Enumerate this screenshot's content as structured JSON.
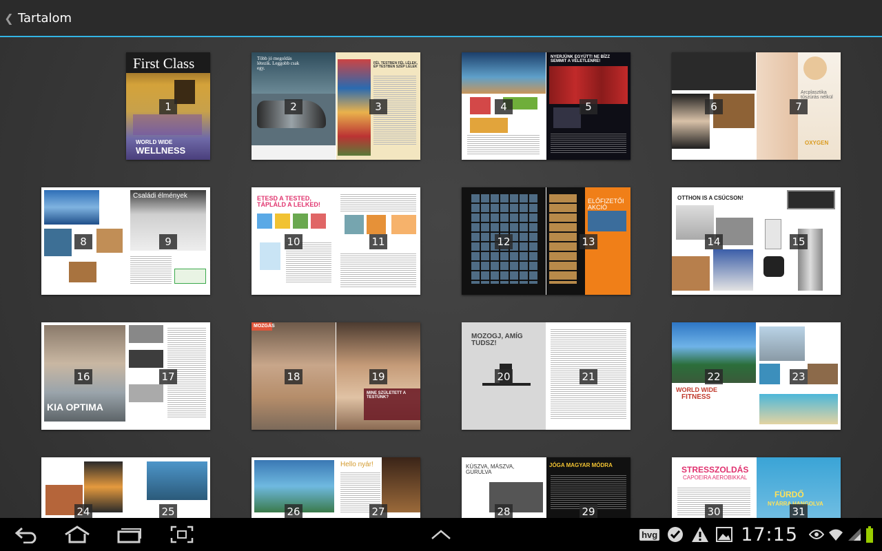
{
  "actionbar": {
    "title": "Tartalom",
    "back_icon": "chevron-left-icon"
  },
  "spreads": [
    {
      "pages": [
        "1"
      ],
      "cover_title": "First Class",
      "cover_tag": "WORLD WIDE",
      "cover_sub": "WELLNESS"
    },
    {
      "pages": [
        "2",
        "3"
      ],
      "left_text": "Több jó megoldás létezik. Leggobb csak egy.",
      "right_text": "FÉL TESTBEN FÉL LÉLEK, ÉP TESTBEN SZÉP LÉLEK"
    },
    {
      "pages": [
        "4",
        "5"
      ],
      "right_text": "NYERJÜNK EGYÜTT! NE BÍZZ SEMMIT A VÉLETLENRE!"
    },
    {
      "pages": [
        "6",
        "7"
      ],
      "right_text": "Arcplasztika tűszúrás nélkül",
      "right_sub": "OXYGEN"
    },
    {
      "pages": [
        "8",
        "9"
      ],
      "right_text": "Családi élmények"
    },
    {
      "pages": [
        "10",
        "11"
      ],
      "left_text": "ETESD A TESTED, TÁPLÁLD A LELKED!"
    },
    {
      "pages": [
        "12",
        "13"
      ],
      "right_text": "ELŐFIZETŐI AKCIÓ"
    },
    {
      "pages": [
        "14",
        "15"
      ],
      "left_text": "OTTHON IS A CSÚCSON!"
    },
    {
      "pages": [
        "16",
        "17"
      ],
      "left_text": "KIA OPTIMA"
    },
    {
      "pages": [
        "18",
        "19"
      ],
      "left_tag": "MOZGÁS",
      "right_text": "MINE SZÜLETETT A TESTÜNK?"
    },
    {
      "pages": [
        "20",
        "21"
      ],
      "left_text": "MOZOGJ, AMÍG TUDSZ!"
    },
    {
      "pages": [
        "22",
        "23"
      ],
      "left_text": "WORLD WIDE",
      "left_sub": "FITNESS"
    },
    {
      "pages": [
        "24",
        "25"
      ]
    },
    {
      "pages": [
        "26",
        "27"
      ],
      "right_text": "Hello nyár!"
    },
    {
      "pages": [
        "28",
        "29"
      ],
      "left_text": "KÚSZVA, MÁSZVA, GURULVA",
      "right_text": "JÓGA MAGYAR MÓDRA"
    },
    {
      "pages": [
        "30",
        "31"
      ],
      "left_text": "STRESSZOLDÁS",
      "left_sub": "CAPOEIRA AEROBIKKAL",
      "right_text": "FÜRDŐ",
      "right_sub": "NYÁRRA HANGOLVA"
    }
  ],
  "navbar": {
    "back_icon": "back-arrow-icon",
    "home_icon": "home-icon",
    "recents_icon": "recent-apps-icon",
    "screenshot_icon": "screenshot-icon",
    "up_icon": "chevron-up-icon"
  },
  "status": {
    "app_badge": "hvg",
    "clock": "17:15"
  },
  "colors": {
    "accent": "#33b5e5",
    "background": "#3a3a3a",
    "navbar": "#000000",
    "battery": "#99cc00"
  }
}
